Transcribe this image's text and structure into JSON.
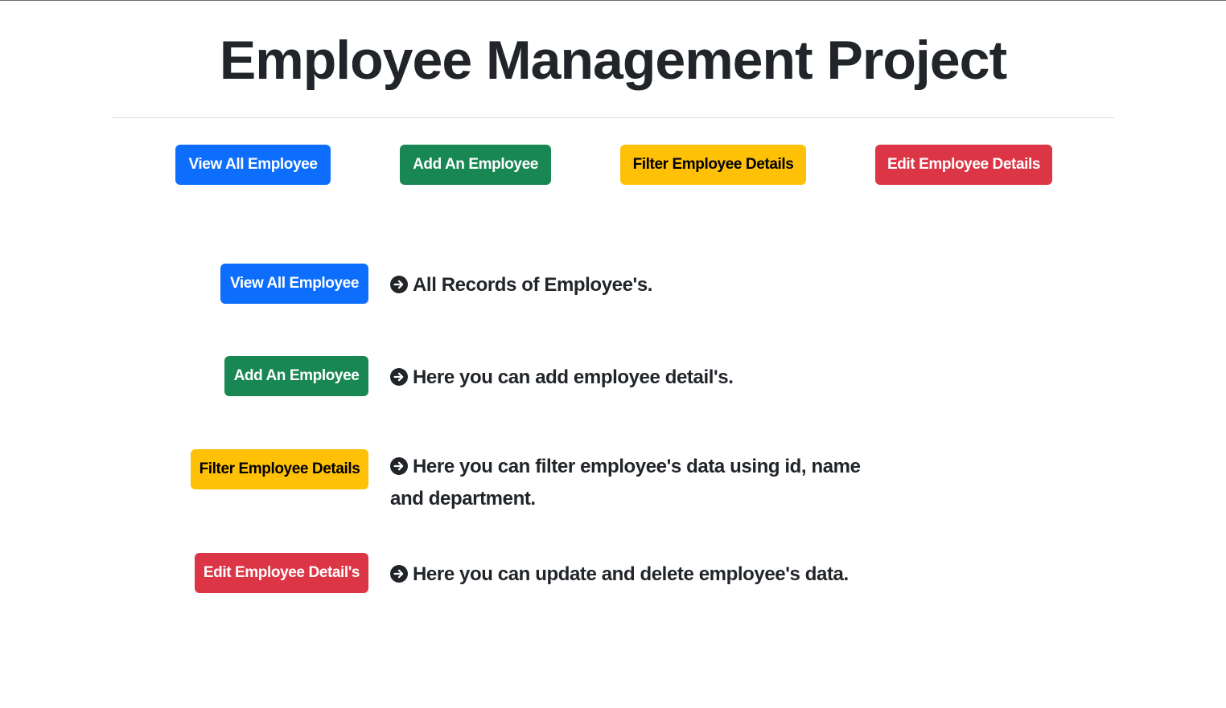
{
  "header": {
    "title": "Employee Management Project"
  },
  "nav": {
    "buttons": [
      {
        "label": "View All Employee",
        "color": "#0d6efd"
      },
      {
        "label": "Add An Employee",
        "color": "#198754"
      },
      {
        "label": "Filter Employee Details",
        "color": "#ffc107"
      },
      {
        "label": "Edit Employee Details",
        "color": "#dc3545"
      }
    ]
  },
  "features": [
    {
      "button_label": "View All Employee",
      "description": "All Records of Employee's.",
      "icon": "arrow-right-circle-icon"
    },
    {
      "button_label": "Add An Employee",
      "description": "Here you can add employee detail's.",
      "icon": "arrow-right-circle-icon"
    },
    {
      "button_label": "Filter Employee Details",
      "description": "Here you can filter employee's data using id, name and department.",
      "icon": "arrow-right-circle-icon"
    },
    {
      "button_label": "Edit Employee Detail's",
      "description": "Here you can update and delete employee's data.",
      "icon": "arrow-right-circle-icon"
    }
  ]
}
